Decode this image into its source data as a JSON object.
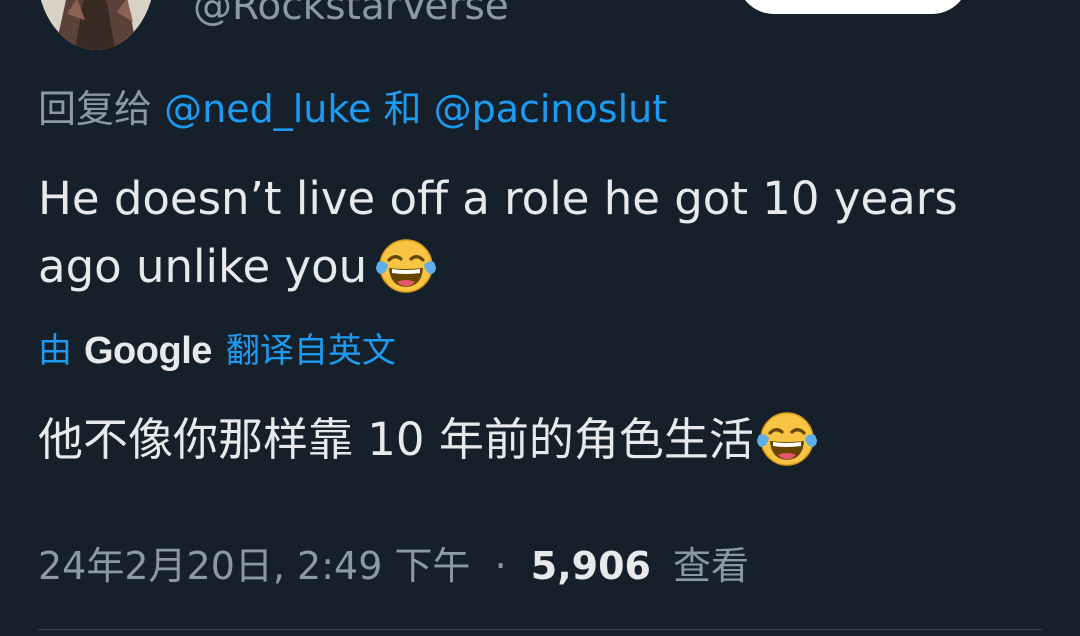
{
  "author": {
    "handle": "@RockstarVerse"
  },
  "reply": {
    "prefix": "回复给",
    "mentions": [
      "@ned_luke",
      "@pacinoslut"
    ],
    "conjunction": "和"
  },
  "tweet": {
    "text": "He doesn’t live off a role he got 10 years ago unlike you",
    "emoji": "face-with-tears-of-joy-emoji"
  },
  "translation": {
    "by_label": "由",
    "provider": "Google",
    "source_label": "翻译自英文",
    "text": "他不像你那样靠 10 年前的角色生活"
  },
  "meta": {
    "timestamp": "24年2月20日, 2:49 下午",
    "separator": "·",
    "views_count": "5,906",
    "views_label": "查看"
  },
  "colors": {
    "background": "#15202b",
    "text_primary": "#e7e9ea",
    "text_secondary": "#8b98a5",
    "link": "#1d9bf0",
    "divider": "#38444d"
  }
}
